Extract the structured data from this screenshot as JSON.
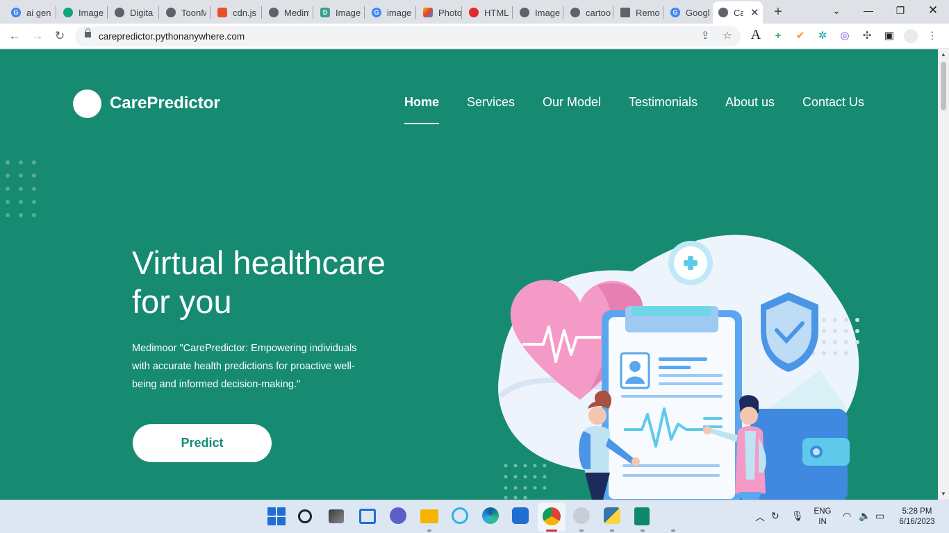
{
  "browser": {
    "tabs": [
      {
        "label": "ai gen",
        "icon": "google-icon",
        "color": "#4285f4"
      },
      {
        "label": "Image",
        "icon": "openai-icon",
        "color": "#10a37f"
      },
      {
        "label": "Digita",
        "icon": "globe-icon",
        "color": "#5f6368"
      },
      {
        "label": "ToonM",
        "icon": "globe-icon",
        "color": "#5f6368"
      },
      {
        "label": "cdn.js",
        "icon": "shield-icon",
        "color": "#e8502d"
      },
      {
        "label": "Medim",
        "icon": "globe-icon",
        "color": "#5f6368"
      },
      {
        "label": "Image",
        "icon": "d-icon",
        "color": "#3f9e8e"
      },
      {
        "label": "image",
        "icon": "google-icon",
        "color": "#4285f4"
      },
      {
        "label": "Photo",
        "icon": "colorful-icon",
        "color": "#f4b400"
      },
      {
        "label": "HTML",
        "icon": "opera-icon",
        "color": "#e0282e"
      },
      {
        "label": "Image",
        "icon": "bug-icon",
        "color": "#5f6368"
      },
      {
        "label": "cartoo",
        "icon": "globe-icon",
        "color": "#5f6368"
      },
      {
        "label": "Remo",
        "icon": "layers-icon",
        "color": "#5f6368"
      },
      {
        "label": "Googl",
        "icon": "google-icon",
        "color": "#4285f4"
      },
      {
        "label": "Ca",
        "icon": "globe-icon",
        "color": "#5f6368",
        "active": true
      }
    ],
    "url": "carepredictor.pythonanywhere.com"
  },
  "site": {
    "brand": "CarePredictor",
    "nav": [
      {
        "label": "Home",
        "active": true
      },
      {
        "label": "Services"
      },
      {
        "label": "Our Model"
      },
      {
        "label": "Testimonials"
      },
      {
        "label": "About us"
      },
      {
        "label": "Contact Us"
      }
    ],
    "hero": {
      "title_line1": "Virtual healthcare",
      "title_line2": "for you",
      "description": "Medimoor \"CarePredictor: Empowering individuals with accurate health predictions for proactive well-being and informed decision-making.\"",
      "button": "Predict"
    },
    "colors": {
      "background": "#168b72",
      "accent": "#ffffff"
    }
  },
  "taskbar": {
    "language": "ENG",
    "region": "IN",
    "time": "5:28 PM",
    "date": "6/16/2023"
  }
}
